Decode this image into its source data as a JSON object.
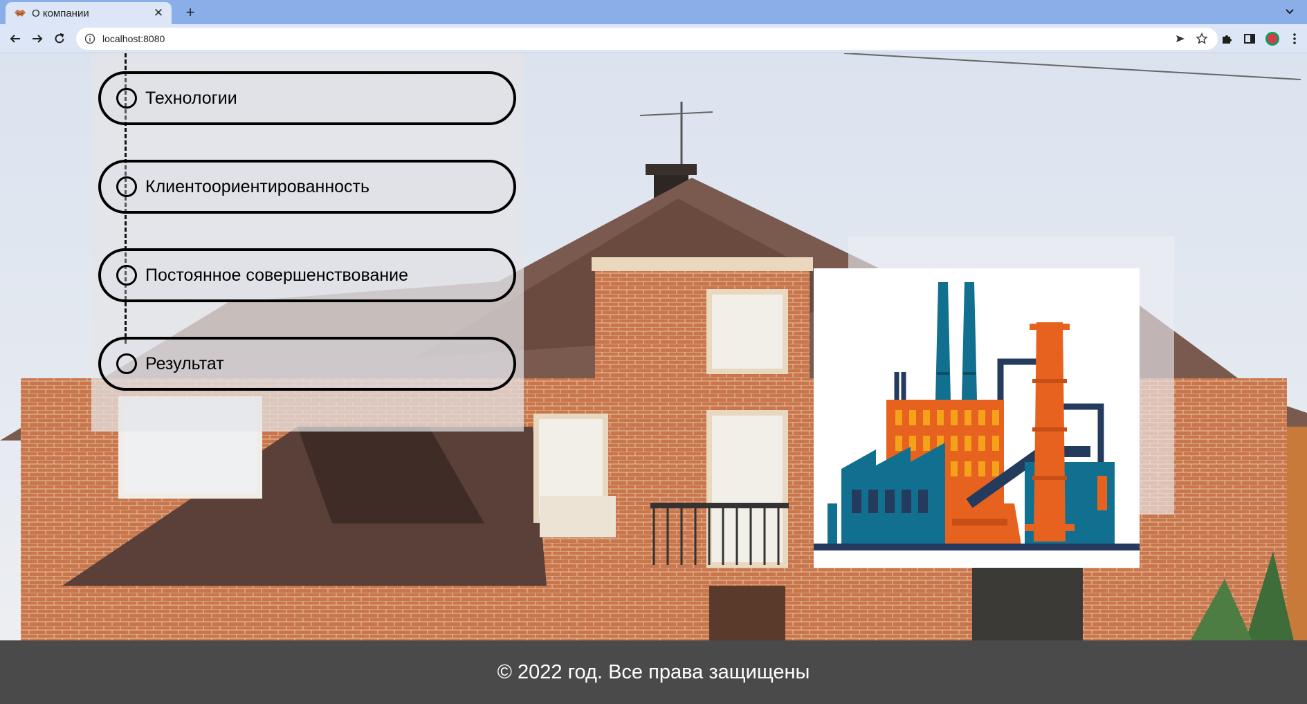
{
  "browser": {
    "tab_title": "О компании",
    "tab_close_icon": "close-icon",
    "new_tab_icon": "plus-icon",
    "url": "localhost:8080"
  },
  "timeline": {
    "steps": [
      {
        "label": "Технологии"
      },
      {
        "label": "Клиентоориентированность"
      },
      {
        "label": "Постоянное совершенствование"
      },
      {
        "label": "Результат"
      }
    ]
  },
  "illustration": {
    "icon": "factory-icon",
    "colors": {
      "teal": "#11708f",
      "orange": "#e8621f",
      "navy": "#243b5e"
    }
  },
  "background_image": "house-photo",
  "footer": {
    "text": "© 2022 год. Все права защищены",
    "background": "#4a4a4a"
  }
}
